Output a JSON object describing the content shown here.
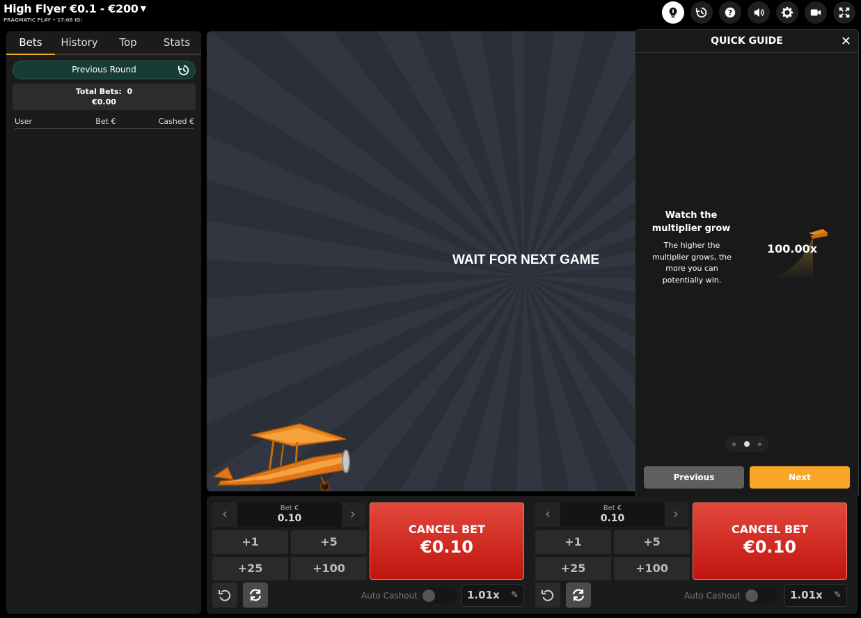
{
  "header": {
    "title": "High Flyer €0.1 - €200",
    "subtitle": "PRAGMATIC PLAY • 17:08 ID:",
    "icons": [
      "lightbulb-icon",
      "history-icon",
      "help-icon",
      "sound-icon",
      "settings-icon",
      "video-icon",
      "fullscreen-icon"
    ]
  },
  "left_panel": {
    "tabs": [
      {
        "label": "Bets",
        "selected": true
      },
      {
        "label": "History"
      },
      {
        "label": "Top"
      },
      {
        "label": "Stats"
      }
    ],
    "previous_round_label": "Previous Round",
    "total_bets_label": "Total Bets:",
    "total_bets_count": "0",
    "total_amount": "€0.00",
    "columns": [
      "User",
      "Bet €",
      "Cashed €"
    ]
  },
  "game": {
    "status_text": "WAIT FOR NEXT GAME"
  },
  "quick_guide": {
    "title": "QUICK GUIDE",
    "heading": "Watch the multiplier grow",
    "body": "The higher the multiplier grows, the more you can potentially win.",
    "multiplier": "100.00x",
    "page": 2,
    "pages": 3,
    "previous_label": "Previous",
    "next_label": "Next"
  },
  "bet_panels": [
    {
      "bet_label": "Bet €",
      "bet_value": "0.10",
      "quick_adds": [
        "+1",
        "+5",
        "+25",
        "+100"
      ],
      "cancel_label": "CANCEL BET",
      "cancel_amount": "€0.10",
      "auto_cashout_label": "Auto Cashout",
      "auto_cashout_enabled": false,
      "cashout_value": "1.01x"
    },
    {
      "bet_label": "Bet €",
      "bet_value": "0.10",
      "quick_adds": [
        "+1",
        "+5",
        "+25",
        "+100"
      ],
      "cancel_label": "CANCEL BET",
      "cancel_amount": "€0.10",
      "auto_cashout_label": "Auto Cashout",
      "auto_cashout_enabled": false,
      "cashout_value": "1.01x"
    }
  ],
  "colors": {
    "accent": "#f7a625",
    "cancel_red": "#d9322a",
    "panel_bg": "#1b1b1b"
  }
}
